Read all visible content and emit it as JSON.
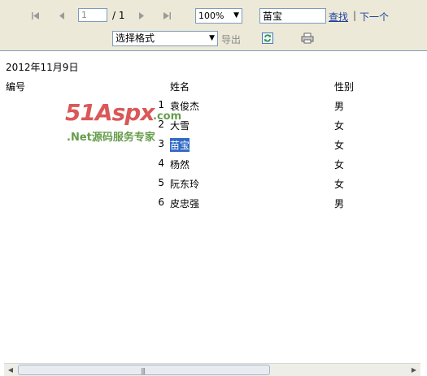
{
  "toolbar": {
    "page_current": "1",
    "page_total": "/ 1",
    "zoom": "100%",
    "search_value": "苗宝",
    "find_label": "查找",
    "separator": "|",
    "next_label": "下一个",
    "format_select": "选择格式",
    "export_label": "导出"
  },
  "report": {
    "date": "2012年11月9日",
    "headers": [
      "编号",
      "姓名",
      "性别"
    ],
    "rows": [
      {
        "num": "1",
        "name": "袁俊杰",
        "gender": "男"
      },
      {
        "num": "2",
        "name": "大雪",
        "gender": "女"
      },
      {
        "num": "3",
        "name": "苗宝",
        "gender": "女"
      },
      {
        "num": "4",
        "name": "杨然",
        "gender": "女"
      },
      {
        "num": "5",
        "name": "阮东玲",
        "gender": "女"
      },
      {
        "num": "6",
        "name": "皮忠强",
        "gender": "男"
      }
    ]
  },
  "watermark": {
    "main": "51Aspx",
    "com": ".com",
    "sub": ".Net源码服务专家"
  },
  "icons": {
    "first_page": "first-page-icon",
    "prev_page": "previous-page-icon",
    "next_page": "next-page-icon",
    "last_page": "last-page-icon",
    "refresh": "refresh-icon",
    "print": "print-icon"
  },
  "colors": {
    "toolbar_bg": "#ece9d8",
    "link": "#1f3fa0",
    "highlight": "#3169c6"
  }
}
